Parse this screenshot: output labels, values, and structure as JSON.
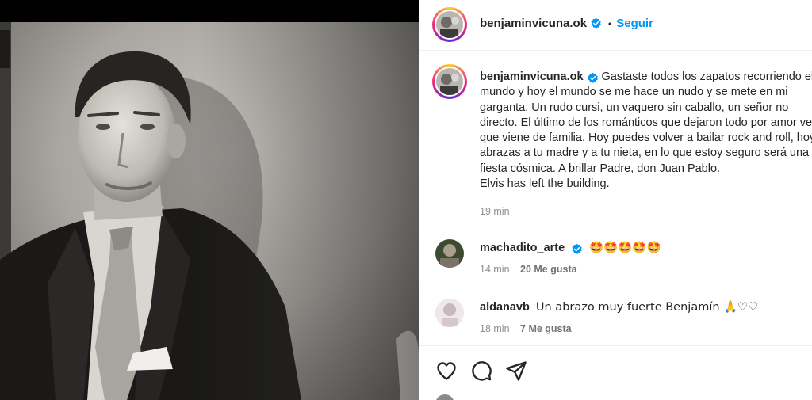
{
  "post": {
    "author": "benjaminvicuna.ok",
    "follow_label": "Seguir",
    "dot": "•",
    "caption": "Gastaste todos los zapatos recorriendo el mundo y hoy el mundo se me hace un nudo y se mete en mi garganta. Un rudo cursi, un vaquero sin caballo, un señor no directo. El último de los románticos que dejaron todo por amor veo que viene de familia. Hoy puedes volver a bailar rock and roll, hoy abrazas a tu madre y a tu nieta, en lo que estoy seguro será una fiesta cósmica. A brillar Padre, don Juan Pablo.\nElvis has left the building.",
    "caption_time": "19 min"
  },
  "comments": [
    {
      "user": "machadito_arte",
      "text": "🤩🤩🤩🤩🤩",
      "time": "14 min",
      "likes": "20 Me gusta"
    },
    {
      "user": "aldanavb",
      "text": "Un abrazo muy fuerte Benjamín 🙏♡♡",
      "time": "18 min",
      "likes": "7 Me gusta"
    }
  ],
  "icons": {
    "verified": "verified-badge-icon",
    "like": "heart-icon",
    "comment": "comment-icon",
    "share": "share-icon"
  },
  "colors": {
    "follow": "#0095f6",
    "verified": "#0095f6",
    "muted": "#8e8e8e"
  }
}
